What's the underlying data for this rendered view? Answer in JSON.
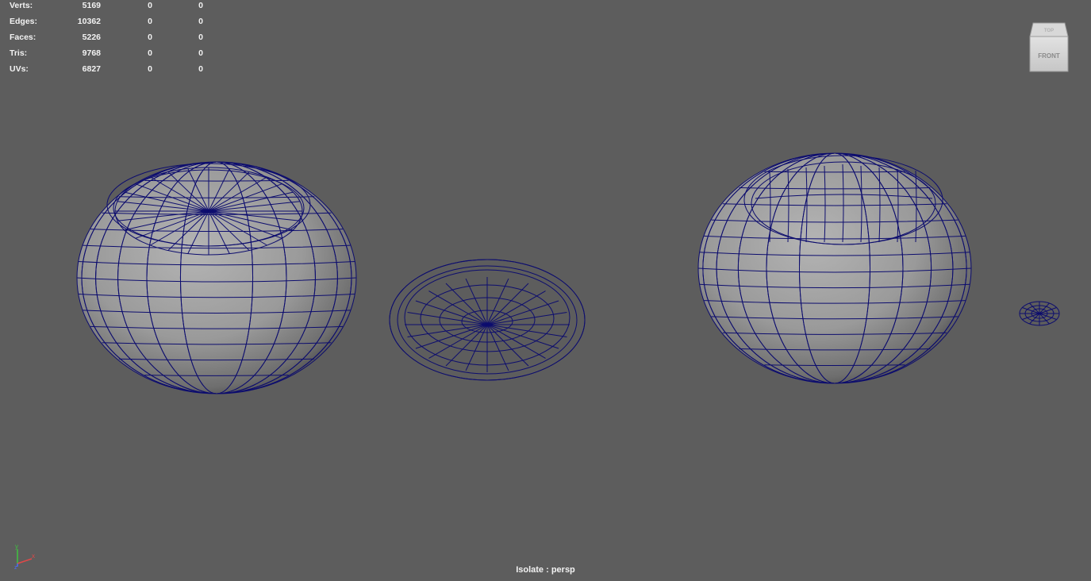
{
  "hud": {
    "rows": [
      {
        "label": "Verts:",
        "v1": "5169",
        "v2": "0",
        "v3": "0"
      },
      {
        "label": "Edges:",
        "v1": "10362",
        "v2": "0",
        "v3": "0"
      },
      {
        "label": "Faces:",
        "v1": "5226",
        "v2": "0",
        "v3": "0"
      },
      {
        "label": "Tris:",
        "v1": "9768",
        "v2": "0",
        "v3": "0"
      },
      {
        "label": "UVs:",
        "v1": "6827",
        "v2": "0",
        "v3": "0"
      }
    ]
  },
  "viewcube": {
    "top_label": "TOP",
    "front_label": "FRONT"
  },
  "axis": {
    "x": "x",
    "y": "y",
    "z": "z"
  },
  "status": {
    "isolate_label": "Isolate : persp"
  },
  "colors": {
    "background": "#5d5d5d",
    "wireframe": "#0d0d6e",
    "text": "#f2f2f2"
  }
}
